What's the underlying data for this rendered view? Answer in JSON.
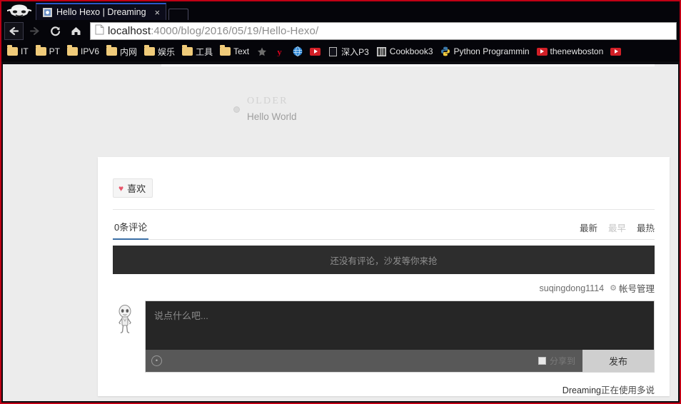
{
  "browser": {
    "logo_icon": "anonymous-mask-icon",
    "tab": {
      "title": "Hello Hexo | Dreaming",
      "favicon": "page-favicon",
      "close_label": "×"
    },
    "newtab_label": "",
    "nav": {
      "back_icon": "←",
      "forward_icon": "→",
      "reload_icon": "⟳",
      "home_icon": "⌂"
    },
    "url": {
      "host": "localhost",
      "rest": ":4000/blog/2016/05/19/Hello-Hexo/",
      "page_icon": "document-icon"
    },
    "bookmarks": [
      {
        "label": "IT",
        "icon": "folder-icon"
      },
      {
        "label": "PT",
        "icon": "folder-icon"
      },
      {
        "label": "IPV6",
        "icon": "folder-icon"
      },
      {
        "label": "内网",
        "icon": "folder-icon"
      },
      {
        "label": "娱乐",
        "icon": "folder-icon"
      },
      {
        "label": "工具",
        "icon": "folder-icon"
      },
      {
        "label": "Text",
        "icon": "folder-icon"
      },
      {
        "label": "",
        "icon": "star-icon"
      },
      {
        "label": "",
        "icon": "y-letter-icon"
      },
      {
        "label": "",
        "icon": "globe-icon"
      },
      {
        "label": "",
        "icon": "youtube-icon"
      },
      {
        "label": "深入P3",
        "icon": "document-icon"
      },
      {
        "label": "Cookbook3",
        "icon": "book-icon"
      },
      {
        "label": "Python Programmin",
        "icon": "python-icon"
      },
      {
        "label": "thenewboston",
        "icon": "youtube-icon"
      },
      {
        "label": "",
        "icon": "youtube-icon"
      }
    ]
  },
  "page": {
    "postnav": {
      "kicker": "OLDER",
      "title": "Hello World",
      "dot_icon": "timeline-dot-icon"
    },
    "comments": {
      "like_button": {
        "label": "喜欢",
        "icon": "heart-icon"
      },
      "tab_label": "0条评论",
      "sorts": [
        {
          "label": "最新",
          "active": true
        },
        {
          "label": "最早",
          "active": false
        },
        {
          "label": "最热",
          "active": true
        }
      ],
      "empty_text": "还没有评论，沙发等你来抢",
      "username": "suqingdong1114",
      "account_label": "帐号管理",
      "account_icon": "gear-icon",
      "avatar_icon": "user-avatar-icon",
      "editor_placeholder": "说点什么吧...",
      "emoji_icon": "emoji-icon",
      "share_label": "分享到",
      "publish_label": "发布",
      "footer_brand": "Dreaming",
      "footer_text": "正在使用多说"
    }
  },
  "colors": {
    "accent_tab": "#2b57c9",
    "tab_underline": "#3a6ea5",
    "heart": "#e8566b",
    "frame_border": "#c00014",
    "banner_bg": "#2d2d2d",
    "textarea_bg": "#262626",
    "toolbar_bg": "#585858"
  }
}
